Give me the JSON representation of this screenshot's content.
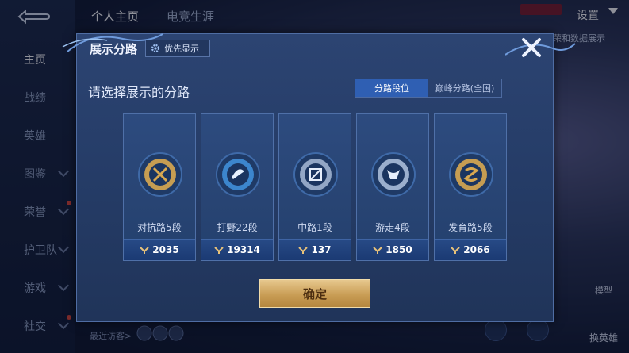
{
  "nav": {
    "items": [
      {
        "label": "主页",
        "active": true,
        "has_chevron": false,
        "has_dot": false
      },
      {
        "label": "战绩",
        "active": false,
        "has_chevron": false,
        "has_dot": false
      },
      {
        "label": "英雄",
        "active": false,
        "has_chevron": false,
        "has_dot": false
      },
      {
        "label": "图鉴",
        "active": false,
        "has_chevron": true,
        "has_dot": false
      },
      {
        "label": "荣誉",
        "active": false,
        "has_chevron": true,
        "has_dot": true
      },
      {
        "label": "护卫队",
        "active": false,
        "has_chevron": true,
        "has_dot": false
      },
      {
        "label": "游戏",
        "active": false,
        "has_chevron": true,
        "has_dot": false
      },
      {
        "label": "社交",
        "active": false,
        "has_chevron": true,
        "has_dot": true
      }
    ]
  },
  "top": {
    "tabs": [
      "个人主页",
      "电竞生涯"
    ],
    "settings_label": "设置",
    "right_label": "荣和数据展示"
  },
  "bottom": {
    "recent_label": "最近访客>",
    "btn_a_label": "模型",
    "btn_b_label": "换英雄"
  },
  "dialog": {
    "title": "展示分路",
    "pref_label": "优先显示",
    "prompt": "请选择展示的分路",
    "toggle": [
      "分路段位",
      "巅峰分路(全国)"
    ],
    "toggle_selected": 0,
    "confirm_label": "确定"
  },
  "lanes": [
    {
      "name": "对抗路5段",
      "score": "2035",
      "emblem": "clash-lane-emblem-icon",
      "color": "#d8a850"
    },
    {
      "name": "打野22段",
      "score": "19314",
      "emblem": "jungle-emblem-icon",
      "color": "#3f8fd8"
    },
    {
      "name": "中路1段",
      "score": "137",
      "emblem": "mid-lane-emblem-icon",
      "color": "#9fb3cf"
    },
    {
      "name": "游走4段",
      "score": "1850",
      "emblem": "roam-emblem-icon",
      "color": "#a9bcd8"
    },
    {
      "name": "发育路5段",
      "score": "2066",
      "emblem": "farm-lane-emblem-icon",
      "color": "#d8a850"
    }
  ]
}
